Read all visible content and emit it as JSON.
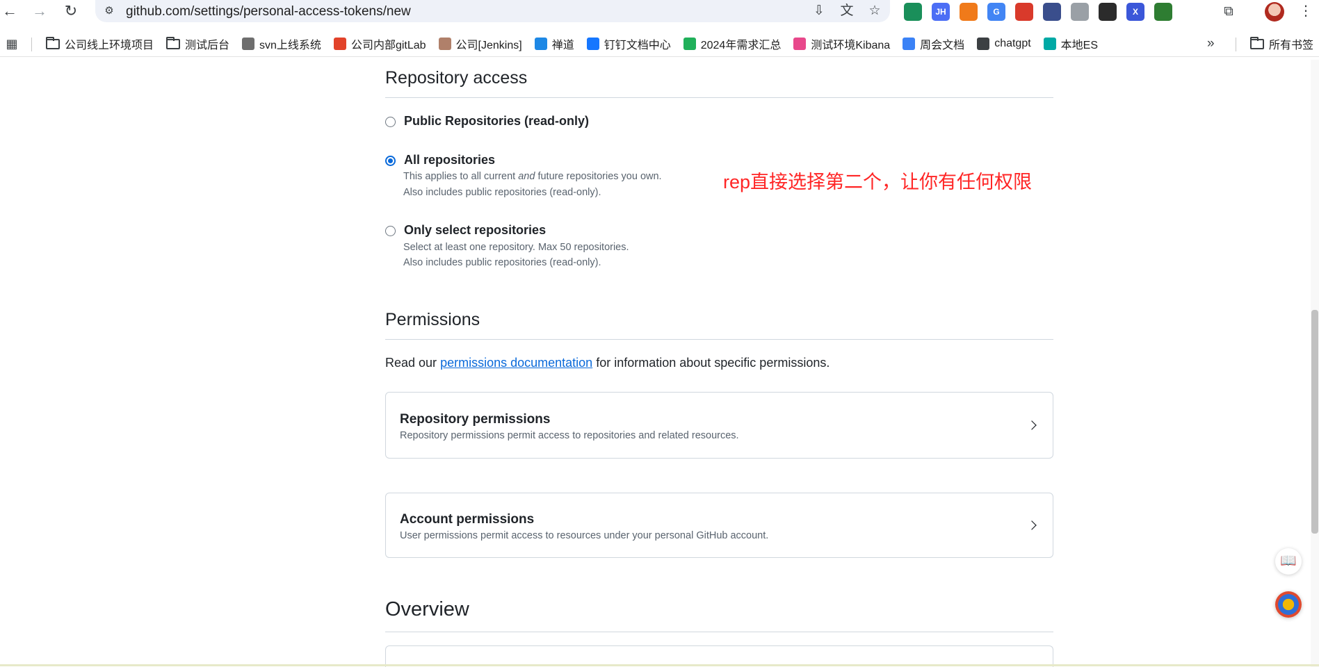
{
  "browser": {
    "url": "github.com/settings/personal-access-tokens/new",
    "nav": {
      "back": "←",
      "forward": "→",
      "reload": "↻"
    },
    "extensions": [
      {
        "name": "extension-green-icon",
        "color": "#1a8f5a",
        "label": ""
      },
      {
        "name": "jh-extension-icon",
        "color": "#4c6ef5",
        "label": "JH"
      },
      {
        "name": "orange-extension-icon",
        "color": "#f07a1a",
        "label": ""
      },
      {
        "name": "google-translate-icon",
        "color": "#4285f4",
        "label": "G"
      },
      {
        "name": "red-extension-icon",
        "color": "#d93a2b",
        "label": ""
      },
      {
        "name": "blue-extension-icon",
        "color": "#3a4e8c",
        "label": ""
      },
      {
        "name": "vue-devtools-icon",
        "color": "#9aa0a6",
        "label": ""
      },
      {
        "name": "mask-extension-icon",
        "color": "#2b2b2b",
        "label": ""
      },
      {
        "name": "x-extension-icon",
        "color": "#3b57d9",
        "label": "X"
      },
      {
        "name": "green-box-extension-icon",
        "color": "#2e7d32",
        "label": ""
      }
    ]
  },
  "bookmarks": {
    "items": [
      {
        "label": "公司线上环境项目",
        "icon": "folder-icon",
        "color": ""
      },
      {
        "label": "测试后台",
        "icon": "folder-icon",
        "color": ""
      },
      {
        "label": "svn上线系统",
        "icon": "svn-icon",
        "color": "#6e6e6e"
      },
      {
        "label": "公司内部gitLab",
        "icon": "gitlab-icon",
        "color": "#e2432a"
      },
      {
        "label": "公司[Jenkins]",
        "icon": "jenkins-icon",
        "color": "#b0806a"
      },
      {
        "label": "禅道",
        "icon": "zentao-icon",
        "color": "#1e88e5"
      },
      {
        "label": "钉钉文档中心",
        "icon": "dingtalk-icon",
        "color": "#1677ff"
      },
      {
        "label": "2024年需求汇总",
        "icon": "sheet-icon",
        "color": "#20b05a"
      },
      {
        "label": "测试环境Kibana",
        "icon": "kibana-icon",
        "color": "#e8488b"
      },
      {
        "label": "周会文档",
        "icon": "doc-icon",
        "color": "#3b82f6"
      },
      {
        "label": "chatgpt",
        "icon": "openai-icon",
        "color": "#3c4043"
      },
      {
        "label": "本地ES",
        "icon": "elastic-icon",
        "color": "#00a9a5"
      }
    ],
    "more": "»",
    "all_bookmarks": "所有书签"
  },
  "repository_access": {
    "title": "Repository access",
    "options": [
      {
        "label": "Public Repositories (read-only)",
        "checked": false,
        "notes": []
      },
      {
        "label": "All repositories",
        "checked": true,
        "notes": [
          {
            "before": "This applies to all current ",
            "em": "and",
            "after": " future repositories you own."
          },
          {
            "before": "Also includes public repositories (read-only).",
            "em": "",
            "after": ""
          }
        ]
      },
      {
        "label": "Only select repositories",
        "checked": false,
        "notes": [
          {
            "before": "Select at least one repository. Max 50 repositories.",
            "em": "",
            "after": ""
          },
          {
            "before": "Also includes public repositories (read-only).",
            "em": "",
            "after": ""
          }
        ]
      }
    ]
  },
  "annotation": "rep直接选择第二个，让你有任何权限",
  "permissions": {
    "title": "Permissions",
    "intro_before": "Read our ",
    "intro_link": "permissions documentation",
    "intro_after": " for information about specific permissions.",
    "cards": [
      {
        "title": "Repository permissions",
        "description": "Repository permissions permit access to repositories and related resources."
      },
      {
        "title": "Account permissions",
        "description": "User permissions permit access to resources under your personal GitHub account."
      }
    ]
  },
  "overview": {
    "title": "Overview"
  }
}
